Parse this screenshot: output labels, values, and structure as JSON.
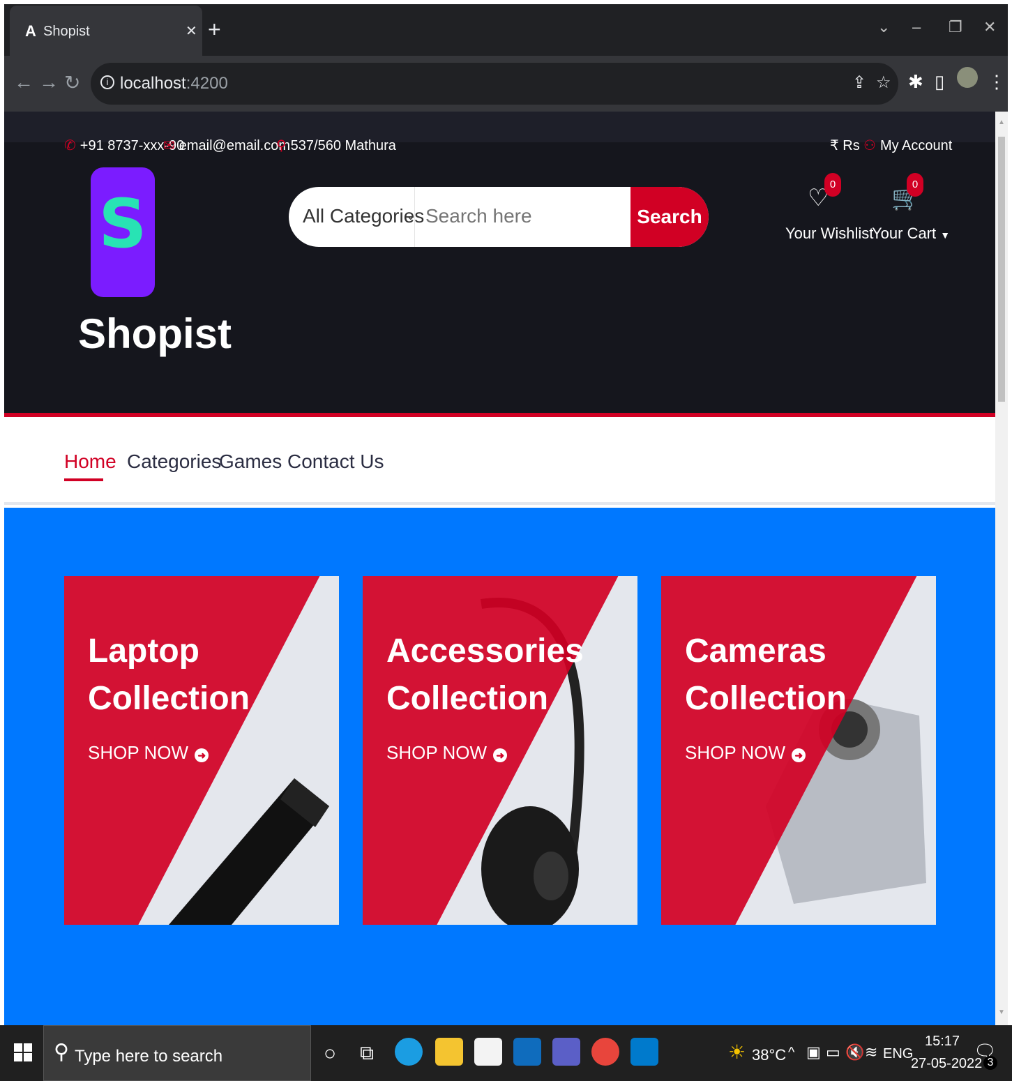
{
  "browser": {
    "tab_title": "Shopist",
    "tab_favicon": "A",
    "url_host": "localhost",
    "url_port": ":4200"
  },
  "topbar": {
    "phone": "+91 8737-xxx-90",
    "email": "email@email.com",
    "address": "537/560 Mathura",
    "currency": "₹ Rs",
    "account": "My Account"
  },
  "logo": {
    "letter": "S",
    "name": "Shopist"
  },
  "search": {
    "category": "All Categories",
    "placeholder": "Search here",
    "button": "Search"
  },
  "wishlist": {
    "label": "Your Wishlist",
    "count": "0"
  },
  "cart": {
    "label": "Your Cart",
    "count": "0"
  },
  "menu": {
    "items": [
      "Home",
      "Categories",
      "Games",
      "Contact Us"
    ]
  },
  "collections": [
    {
      "title": "Laptop Collection",
      "line1": "Laptop",
      "line2": "Collection",
      "link": "SHOP NOW"
    },
    {
      "title": "Accessories Collection",
      "line1": "Accessories",
      "line2": "Collection",
      "link": "SHOP NOW"
    },
    {
      "title": "Cameras Collection",
      "line1": "Cameras",
      "line2": "Collection",
      "link": "SHOP NOW"
    }
  ],
  "taskbar": {
    "search_placeholder": "Type here to search",
    "temperature": "38°C",
    "language": "ENG",
    "time": "15:17",
    "date": "27-05-2022",
    "notifications": "3"
  },
  "colors": {
    "primary": "#d10024",
    "header_bg": "#15161d",
    "hero_bg": "#0078ff",
    "logo_bg": "#7b1cff",
    "logo_letter": "#28e3b4"
  }
}
